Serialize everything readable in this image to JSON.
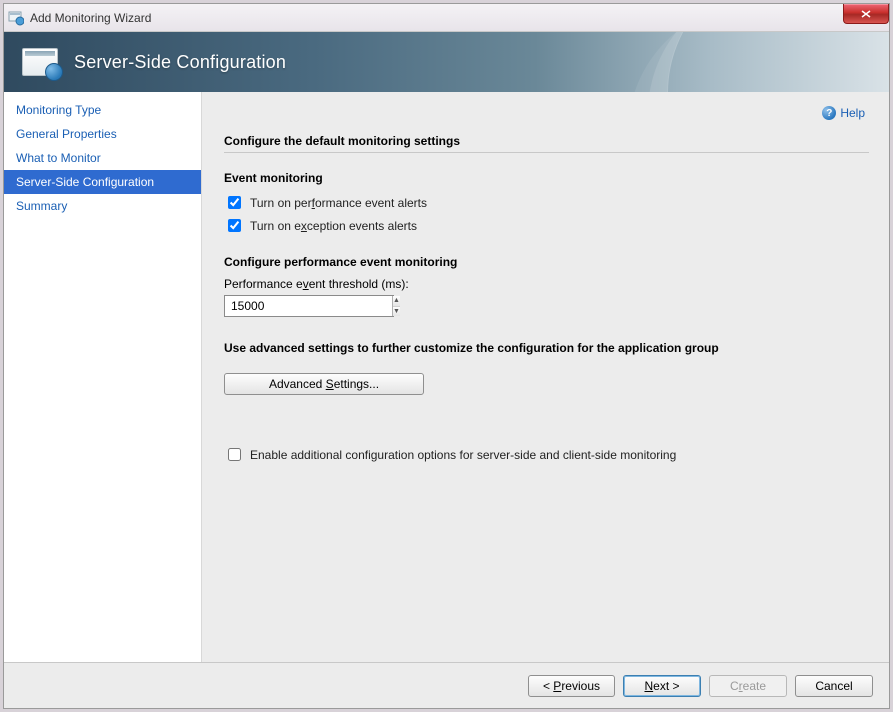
{
  "window": {
    "title": "Add Monitoring Wizard"
  },
  "banner": {
    "title": "Server-Side Configuration"
  },
  "sidebar": {
    "items": [
      {
        "label": "Monitoring Type"
      },
      {
        "label": "General Properties"
      },
      {
        "label": "What to Monitor"
      },
      {
        "label": "Server-Side Configuration"
      },
      {
        "label": "Summary"
      }
    ],
    "active_index": 3
  },
  "help": {
    "label": "Help"
  },
  "main": {
    "heading": "Configure the default monitoring settings",
    "event_monitoring_heading": "Event monitoring",
    "perf_alerts_label": "Turn on performance event alerts",
    "perf_alerts_checked": true,
    "exc_alerts_label": "Turn on exception events alerts",
    "exc_alerts_checked": true,
    "perf_config_heading": "Configure performance event monitoring",
    "threshold_label": "Performance event threshold (ms):",
    "threshold_value": "15000",
    "advanced_heading": "Use advanced settings to further customize the configuration for the application group",
    "advanced_button": "Advanced Settings...",
    "enable_additional_label": "Enable additional configuration options for server-side and client-side monitoring",
    "enable_additional_checked": false
  },
  "footer": {
    "previous": "< Previous",
    "next": "Next >",
    "create": "Create",
    "cancel": "Cancel"
  },
  "accesskeys": {
    "perf_alerts": "f",
    "exc_alerts": "x",
    "threshold": "v",
    "advanced": "S",
    "previous": "P",
    "next": "N",
    "create": "r"
  }
}
